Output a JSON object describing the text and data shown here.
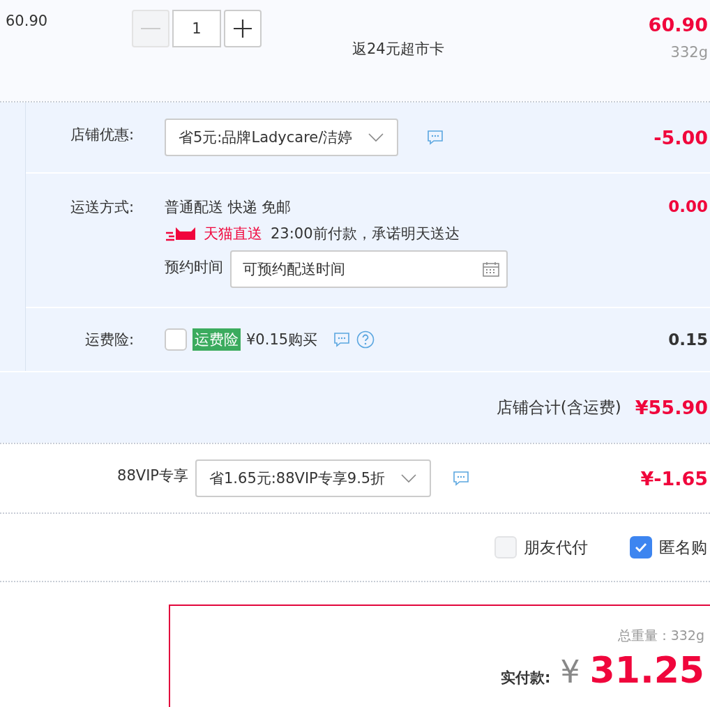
{
  "item": {
    "unit_price": "60.90",
    "quantity": "1",
    "minus_disabled": true,
    "rebate": "返24元超市卡",
    "subtotal": "60.90",
    "weight": "332g"
  },
  "shop": {
    "rows": [
      {
        "kind": "select",
        "label": "店铺优惠:",
        "value": "省5元:品牌Ladycare/洁婷",
        "amount": "-5.00"
      },
      {
        "kind": "shipping",
        "label": "运送方式:",
        "method": "普通配送 快递 免邮",
        "badge": "天猫直送",
        "promise": "23:00前付款，承诺明天送达",
        "schedule_label": "预约时间",
        "schedule_placeholder": "可预约配送时间",
        "amount": "0.00"
      },
      {
        "kind": "insurance",
        "label": "运费险:",
        "checked": false,
        "tag": "运费险",
        "price": "¥0.15购买",
        "amount": "0.15"
      }
    ],
    "total_label": "店铺合计(含运费)",
    "total": "¥55.90"
  },
  "vip": {
    "label": "88VIP专享",
    "value": "省1.65元:88VIP专享9.5折",
    "amount": "¥-1.65"
  },
  "options": [
    {
      "label": "朋友代付",
      "checked": false
    },
    {
      "label": "匿名购",
      "checked": true
    }
  ],
  "summary": {
    "weight_label": "总重量：",
    "weight": "332g",
    "pay_label": "实付款:",
    "currency": "¥",
    "amount": "31.25"
  }
}
